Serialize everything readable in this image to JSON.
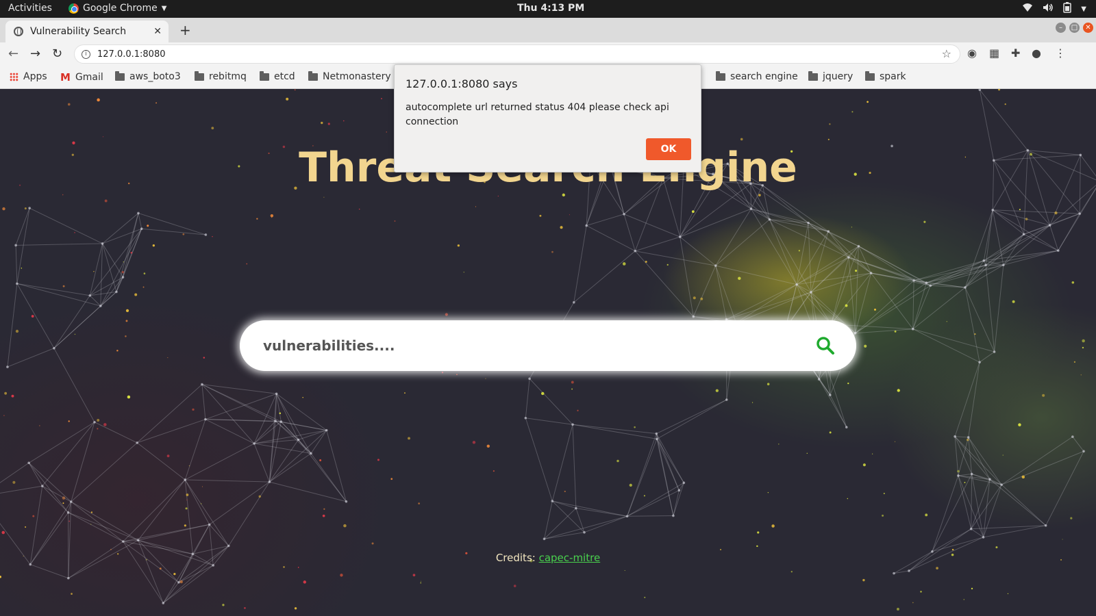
{
  "os_topbar": {
    "activities": "Activities",
    "app_name": "Google Chrome",
    "clock": "Thu  4:13 PM"
  },
  "browser": {
    "tab_title": "Vulnerability Search",
    "url": "127.0.0.1:8080",
    "bookmarks": [
      {
        "label": "Apps",
        "icon": "apps-grid-icon"
      },
      {
        "label": "Gmail",
        "icon": "gmail-icon"
      },
      {
        "label": "aws_boto3",
        "icon": "folder-icon"
      },
      {
        "label": "rebitmq",
        "icon": "folder-icon"
      },
      {
        "label": "etcd",
        "icon": "folder-icon"
      },
      {
        "label": "Netmonastery",
        "icon": "folder-icon"
      },
      {
        "label": "search engine",
        "icon": "folder-icon"
      },
      {
        "label": "jquery",
        "icon": "folder-icon"
      },
      {
        "label": "spark",
        "icon": "folder-icon"
      }
    ]
  },
  "page": {
    "headline": "Threat Search Engine",
    "search_placeholder": "vulnerabilities....",
    "credits_label": "Credits:",
    "credits_link": "capec-mitre",
    "colors": {
      "headline": "#f2d58f",
      "search_icon": "#1faa2e",
      "link": "#49d14d"
    }
  },
  "dialog": {
    "title": "127.0.0.1:8080 says",
    "message": "autocomplete url returned status 404 please check api connection",
    "ok_label": "OK",
    "ok_color": "#f0592b"
  }
}
